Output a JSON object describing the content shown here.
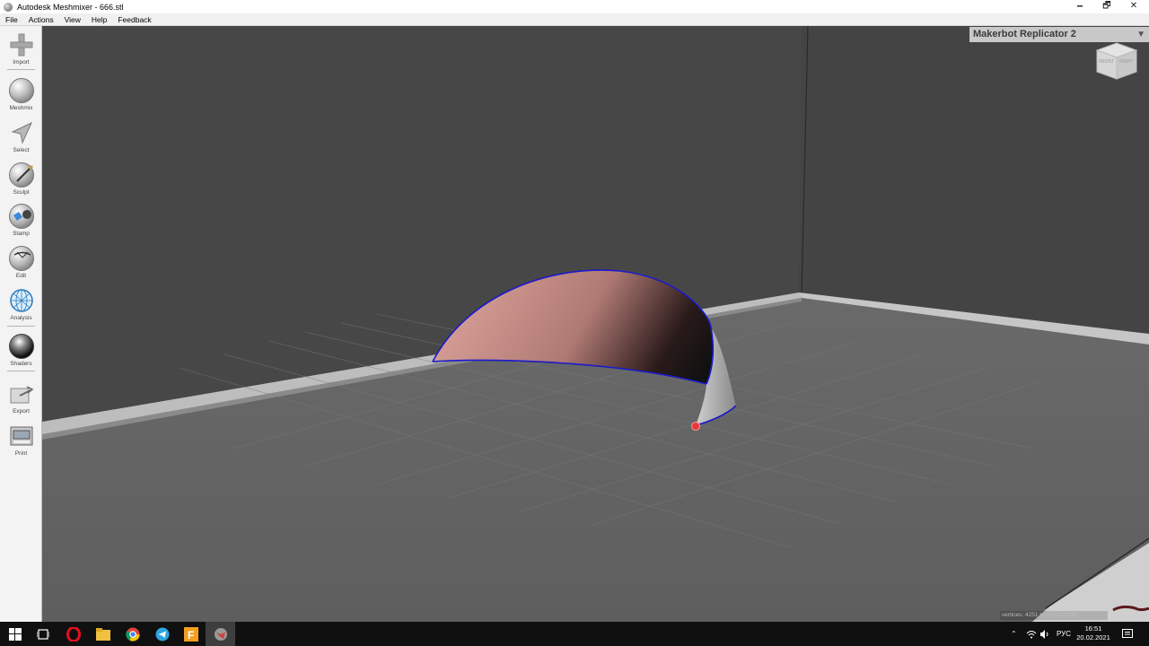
{
  "window": {
    "title": "Autodesk Meshmixer - 666.stl",
    "minimize": "🗕",
    "maximize": "🗗",
    "close": "✕"
  },
  "menu": [
    "File",
    "Actions",
    "View",
    "Help",
    "Feedback"
  ],
  "tools": {
    "import": "Import",
    "meshmix": "Meshmix",
    "select": "Select",
    "sculpt": "Sculpt",
    "stamp": "Stamp",
    "edit": "Edit",
    "analysis": "Analysis",
    "shaders": "Shaders",
    "export": "Export",
    "print": "Print"
  },
  "viewport": {
    "printer": "Makerbot Replicator 2",
    "cube_front": "FRONT",
    "cube_right": "RIGHT",
    "stats": "vertices: 4251 triangles: 8186"
  },
  "taskbar": {
    "lang": "РУС",
    "time": "16:51",
    "date": "20.02.2021"
  },
  "colors": {
    "accent_outline": "#1a1acc",
    "marker": "#e83838"
  }
}
